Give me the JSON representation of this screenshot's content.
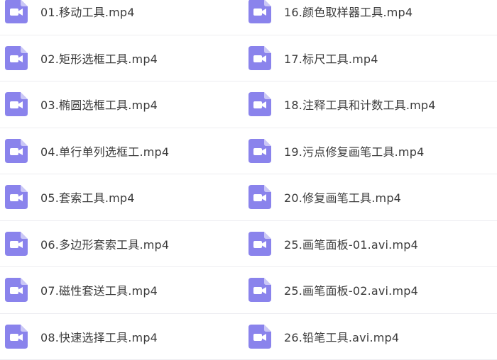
{
  "colors": {
    "icon_bg": "#8a83ec",
    "icon_glyph": "#ffffff",
    "text": "#3b3b3b",
    "divider": "#ededf1"
  },
  "left_files": [
    {
      "name": "01.移动工具.mp4",
      "icon": "video-file-icon"
    },
    {
      "name": "02.矩形选框工具.mp4",
      "icon": "video-file-icon"
    },
    {
      "name": "03.椭圆选框工具.mp4",
      "icon": "video-file-icon"
    },
    {
      "name": "04.单行单列选框工.mp4",
      "icon": "video-file-icon"
    },
    {
      "name": "05.套索工具.mp4",
      "icon": "video-file-icon"
    },
    {
      "name": "06.多边形套索工具.mp4",
      "icon": "video-file-icon"
    },
    {
      "name": "07.磁性套送工具.mp4",
      "icon": "video-file-icon"
    },
    {
      "name": "08.快速选择工具.mp4",
      "icon": "video-file-icon"
    }
  ],
  "right_files": [
    {
      "name": "16.颜色取样器工具.mp4",
      "icon": "video-file-icon"
    },
    {
      "name": "17.标尺工具.mp4",
      "icon": "video-file-icon"
    },
    {
      "name": "18.注释工具和计数工具.mp4",
      "icon": "video-file-icon"
    },
    {
      "name": "19.污点修复画笔工具.mp4",
      "icon": "video-file-icon"
    },
    {
      "name": "20.修复画笔工具.mp4",
      "icon": "video-file-icon"
    },
    {
      "name": "25.画笔面板-01.avi.mp4",
      "icon": "video-file-icon"
    },
    {
      "name": "25.画笔面板-02.avi.mp4",
      "icon": "video-file-icon"
    },
    {
      "name": "26.铅笔工具.avi.mp4",
      "icon": "video-file-icon"
    }
  ]
}
